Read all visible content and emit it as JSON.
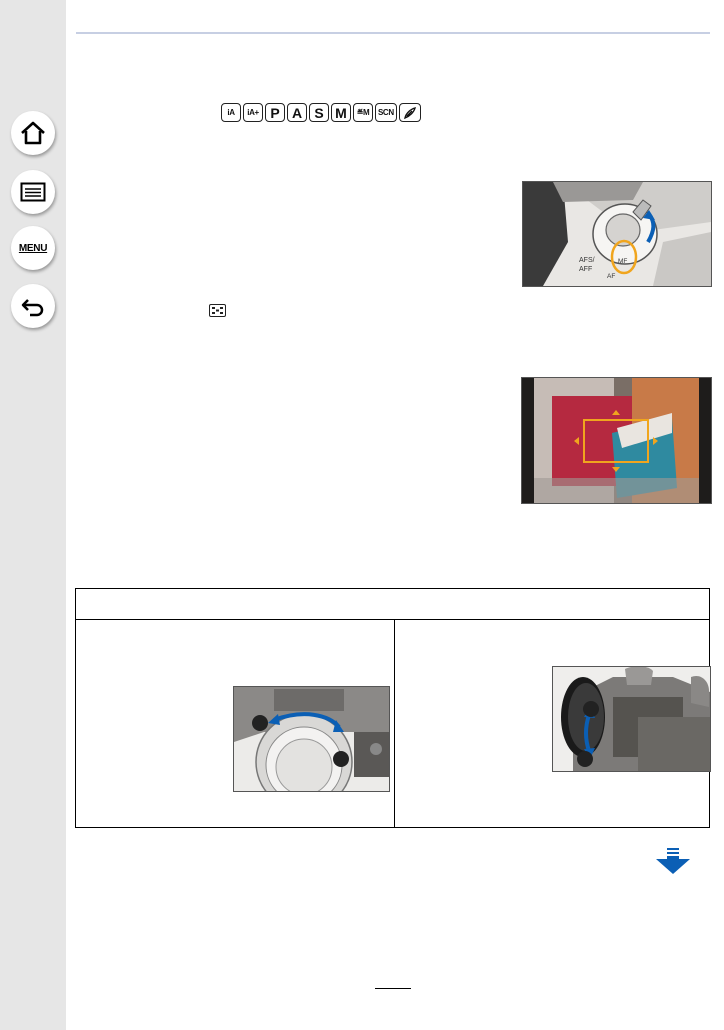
{
  "sidebar": {
    "buttons": [
      {
        "icon": "home-icon"
      },
      {
        "icon": "list-icon"
      },
      {
        "icon": "menu-icon",
        "label": "MENU"
      },
      {
        "icon": "back-icon"
      }
    ]
  },
  "mode_icons": [
    "iA",
    "iA+",
    "P",
    "A",
    "S",
    "M",
    "≝M",
    "SCN",
    "creative-control-icon"
  ],
  "page_number": "",
  "colors": {
    "sidebar": "#e6e6e6",
    "rule": "#c7cfe3",
    "arrow_blue": "#0b5fb5",
    "frame_orange": "#f0a51e"
  }
}
